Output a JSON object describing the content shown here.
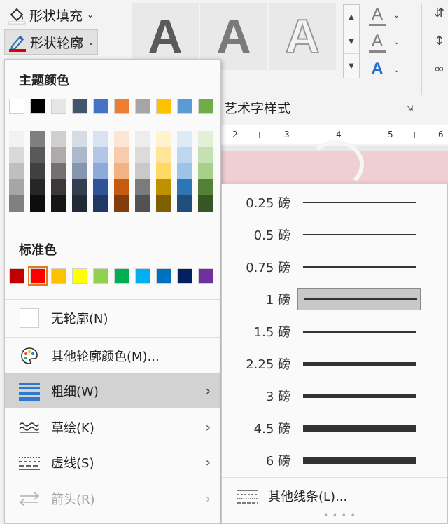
{
  "ribbon": {
    "shape_fill_label": "形状填充",
    "shape_outline_label": "形状轮廓",
    "wordart_styles_label": "艺术字样式",
    "style_tile_letter": "A",
    "text_fill_letter": "A",
    "text_outline_letter": "A",
    "text_effects_letter": "A"
  },
  "ruler": {
    "numbers": [
      "2",
      "3",
      "4",
      "5",
      "6"
    ]
  },
  "menu": {
    "theme_colors_title": "主题颜色",
    "theme_colors": [
      "#ffffff",
      "#000000",
      "#e7e6e6",
      "#44546a",
      "#4472c4",
      "#ed7d31",
      "#a5a5a5",
      "#ffc000",
      "#5b9bd5",
      "#70ad47"
    ],
    "theme_tints": [
      [
        "#f2f2f2",
        "#d9d9d9",
        "#bfbfbf",
        "#a6a6a6",
        "#808080"
      ],
      [
        "#7f7f7f",
        "#595959",
        "#404040",
        "#262626",
        "#0d0d0d"
      ],
      [
        "#d0cece",
        "#aeaaaa",
        "#757070",
        "#3a3838",
        "#171616"
      ],
      [
        "#d6dce4",
        "#adb9ca",
        "#8496b0",
        "#333f4f",
        "#222a35"
      ],
      [
        "#d9e2f3",
        "#b4c6e7",
        "#8eaadb",
        "#2f5496",
        "#1f3864"
      ],
      [
        "#fbe5d5",
        "#f7cbac",
        "#f4b183",
        "#c55a11",
        "#833c0b"
      ],
      [
        "#ededed",
        "#dbdbdb",
        "#c9c9c9",
        "#7b7b7b",
        "#525252"
      ],
      [
        "#fff2cc",
        "#fee599",
        "#ffd965",
        "#bf9000",
        "#7f6000"
      ],
      [
        "#deebf6",
        "#bdd7ee",
        "#9dc3e6",
        "#2e75b5",
        "#1e4e79"
      ],
      [
        "#e2efd9",
        "#c5e0b3",
        "#a8d08d",
        "#538135",
        "#375623"
      ]
    ],
    "standard_colors_title": "标准色",
    "standard_colors": [
      "#c00000",
      "#ff0000",
      "#ffc000",
      "#ffff00",
      "#92d050",
      "#00b050",
      "#00b0f0",
      "#0070c0",
      "#002060",
      "#7030a0"
    ],
    "selected_standard_color": "#ff0000",
    "items": {
      "no_outline": "无轮廓(N)",
      "more_colors": "其他轮廓颜色(M)...",
      "weight": "粗细(W)",
      "sketched": "草绘(K)",
      "dashes": "虚线(S)",
      "arrows": "箭头(R)"
    }
  },
  "weight_submenu": {
    "options": [
      {
        "label": "0.25 磅",
        "pt": 0.25
      },
      {
        "label": "0.5 磅",
        "pt": 0.5
      },
      {
        "label": "0.75 磅",
        "pt": 0.75
      },
      {
        "label": "1 磅",
        "pt": 1
      },
      {
        "label": "1.5 磅",
        "pt": 1.5
      },
      {
        "label": "2.25 磅",
        "pt": 2.25
      },
      {
        "label": "3 磅",
        "pt": 3
      },
      {
        "label": "4.5 磅",
        "pt": 4.5
      },
      {
        "label": "6 磅",
        "pt": 6
      }
    ],
    "selected": "1 磅",
    "more_lines": "其他线条(L)..."
  },
  "colors": {
    "accent_outline_red": "#e00000",
    "selected_highlight": "#c8c8c8",
    "active_item_bg": "#d2d2d2",
    "menu_icon_blue": "#2b79d0"
  }
}
